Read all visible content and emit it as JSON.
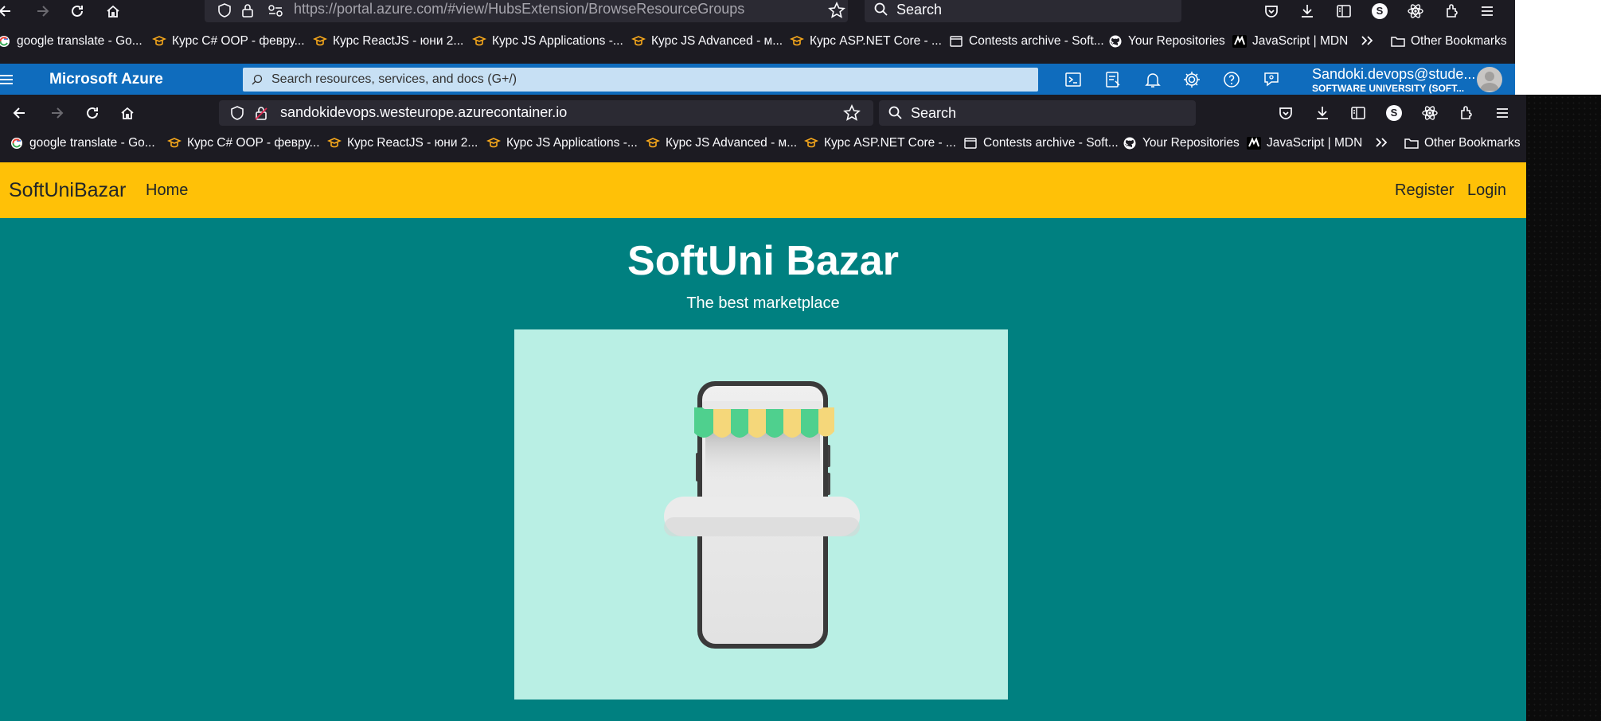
{
  "browser_back": {
    "url": "https://portal.azure.com/#view/HubsExtension/BrowseResourceGroups",
    "search_placeholder": "Search",
    "profile_letter": "S"
  },
  "browser_front": {
    "url": "sandokidevops.westeurope.azurecontainer.io",
    "search_placeholder": "Search",
    "profile_letter": "S"
  },
  "bookmarks": [
    {
      "label": "google translate - Go...",
      "icon": "google-icon"
    },
    {
      "label": "Курс C# OOP - февру...",
      "icon": "softuni-icon"
    },
    {
      "label": "Курс ReactJS - юни 2...",
      "icon": "softuni-icon"
    },
    {
      "label": "Курс JS Applications -...",
      "icon": "softuni-icon"
    },
    {
      "label": "Курс JS Advanced - м...",
      "icon": "softuni-icon"
    },
    {
      "label": "Курс ASP.NET Core - ...",
      "icon": "softuni-icon"
    },
    {
      "label": "Contests archive - Soft...",
      "icon": "page-icon"
    },
    {
      "label": "Your Repositories",
      "icon": "github-icon"
    },
    {
      "label": "JavaScript | MDN",
      "icon": "mdn-icon"
    },
    {
      "label": "Other Bookmarks",
      "icon": "folder-icon"
    }
  ],
  "azure": {
    "title": "Microsoft Azure",
    "search_placeholder": "Search resources, services, and docs (G+/)",
    "user": "Sandoki.devops@stude...",
    "org": "SOFTWARE UNIVERSITY (SOFT..."
  },
  "site": {
    "brand": "SoftUniBazar",
    "nav_home": "Home",
    "nav_register": "Register",
    "nav_login": "Login",
    "hero_title": "SoftUni Bazar",
    "hero_subtitle": "The best marketplace"
  },
  "colors": {
    "navbar": "#ffc107",
    "hero": "#008080",
    "azure_bar": "#0f6cbd"
  }
}
